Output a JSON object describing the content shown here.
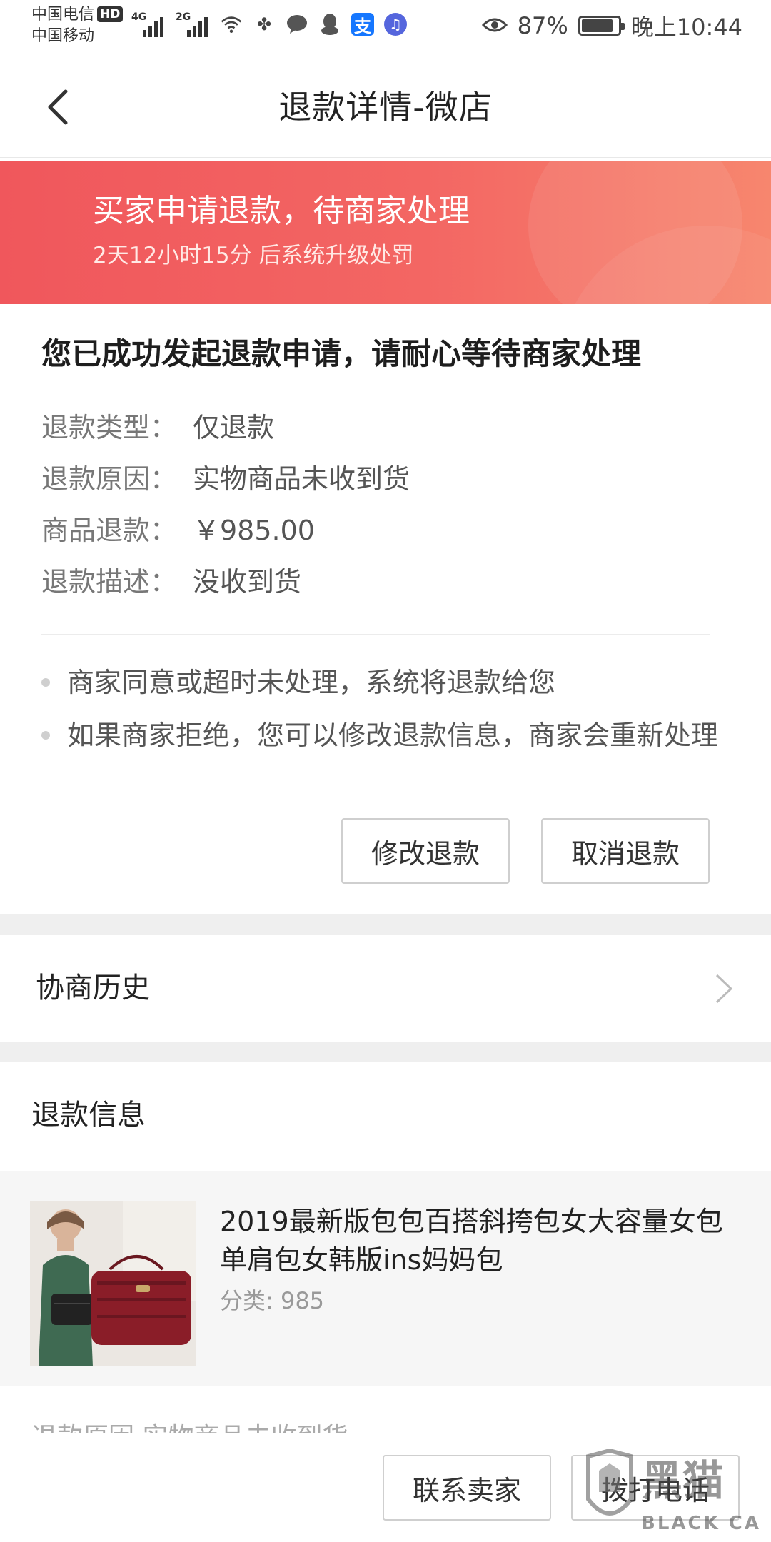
{
  "status_bar": {
    "carrier_1": "中国电信",
    "hd": "HD",
    "carrier_2": "中国移动",
    "sig1_tag": "4G",
    "sig2_tag": "2G",
    "battery_percent": "87%",
    "battery_level": 0.87,
    "time": "晚上10:44",
    "alipay_glyph": "支",
    "icons": [
      "wifi-icon",
      "pinwheel-icon",
      "chat-icon",
      "qq-icon",
      "alipay-icon",
      "music-icon",
      "eye-icon",
      "battery-icon"
    ]
  },
  "header": {
    "title": "退款详情-微店"
  },
  "banner": {
    "title": "买家申请退款，待商家处理",
    "subtitle": "2天12小时15分 后系统升级处罚"
  },
  "status": {
    "heading": "您已成功发起退款申请，请耐心等待商家处理",
    "rows": [
      {
        "label": "退款类型：",
        "value": "仅退款"
      },
      {
        "label": "退款原因：",
        "value": "实物商品未收到货"
      },
      {
        "label": "商品退款：",
        "value": "￥985.00"
      },
      {
        "label": "退款描述：",
        "value": "没收到货"
      }
    ],
    "notes": [
      "商家同意或超时未处理，系统将退款给您",
      "如果商家拒绝，您可以修改退款信息，商家会重新处理"
    ],
    "modify_button": "修改退款",
    "cancel_button": "取消退款"
  },
  "history": {
    "label": "协商历史"
  },
  "refund_info": {
    "heading": "退款信息",
    "product_title": "2019最新版包包百搭斜挎包女大容量女包单肩包女韩版ins妈妈包",
    "product_category": "分类: 985",
    "cut_line": "退款原因  实物商品未收到货"
  },
  "bottom_bar": {
    "contact_seller": "联系卖家",
    "call_phone": "拨打电话"
  },
  "watermark": {
    "text_cn": "黑猫",
    "text_en": "BLACK CAT"
  },
  "colors": {
    "banner_start": "#f0575c",
    "banner_end": "#f7866e",
    "page_bg": "#efefef"
  }
}
